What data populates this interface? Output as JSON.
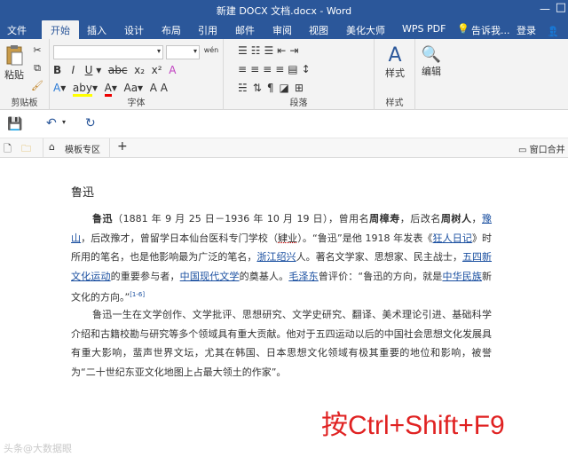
{
  "titlebar": {
    "title": "新建 DOCX 文档.docx - Word",
    "minimize": "—",
    "restore": "□"
  },
  "menu": {
    "items": [
      "文件",
      "开始",
      "插入",
      "设计",
      "布局",
      "引用",
      "邮件",
      "审阅",
      "视图",
      "美化大师",
      "WPS PDF"
    ],
    "tell_me": "告诉我...",
    "login": "登录",
    "share": "共"
  },
  "ribbon": {
    "groups": {
      "clipboard": "剪贴板",
      "font": "字体",
      "paragraph": "段落",
      "styles": "样式"
    },
    "paste": "粘贴",
    "styles_btn": "样式",
    "edit_btn": "编辑",
    "font_size_label": "wén"
  },
  "tabs": {
    "template": "模板专区",
    "add": "+",
    "window_merge": "窗口合并"
  },
  "document": {
    "heading": "鲁迅",
    "p1": {
      "name": "鲁迅",
      "part1": "（1881 年 9 月 25 日－1936 年 10 月 19 日），曾用名",
      "zhou": "周樟寿",
      "part2": "，后改名",
      "zhou2": "周树人",
      "part3": "，",
      "yu1": "豫山",
      "part4": "，",
      "yu2": "豫山",
      "part5": "，后改豫才，曾留学日本仙台医科专门学校（",
      "sy": "肄业",
      "part6": "）。“鲁迅”是他 1918 年发表《",
      "kr": "狂人日记",
      "part7": "》时所用的笔名，也是他影响最为广泛的笔名，",
      "zj": "浙江绍兴",
      "part8": "人。著名文学家、思想家、民主战士，",
      "ws": "五四新文化运动",
      "part9": "的重要参与者，",
      "zgxd": "中国现代文学",
      "part10": "的奠基人。",
      "mzd": "毛泽东",
      "part11": "曾评价：“鲁迅的方向，就是",
      "zhmz": "中华民族",
      "part12": "新文化的方向。”",
      "cite": "[1-6]",
      "yu_display": "豫才"
    },
    "p2": "鲁迅一生在文学创作、文学批评、思想研究、文学史研究、翻译、美术理论引进、基础科学介绍和古籍校勘与研究等多个领域具有重大贡献。他对于五四运动以后的中国社会思想文化发展具有重大影响，蜚声世界文坛，尤其在韩国、日本思想文化领域有极其重要的地位和影响，被誉为“二十世纪东亚文化地图上占最大领土的作家”。"
  },
  "overlay": "按Ctrl+Shift+F9",
  "watermark": "头条@大数据眼",
  "colors": {
    "brand": "#2b579a",
    "link": "#1a4fa0",
    "overlay": "#e02222"
  }
}
